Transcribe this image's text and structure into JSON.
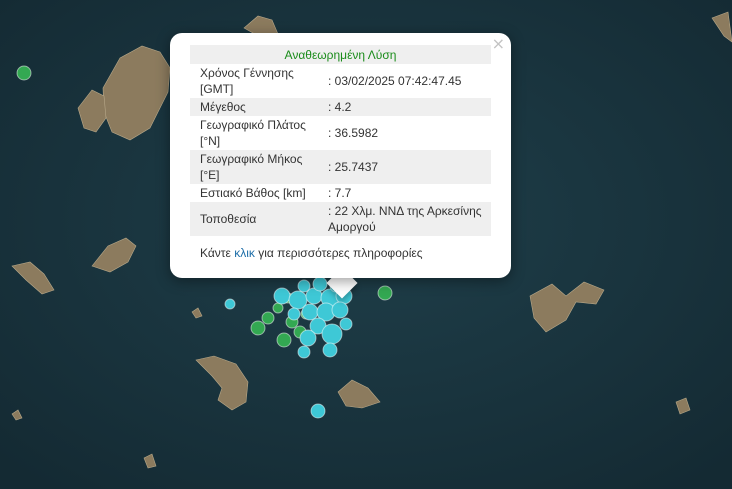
{
  "popup": {
    "title": "Αναθεωρημένη Λύση",
    "close_glyph": "×",
    "rows": [
      {
        "label": "Χρόνος Γέννησης [GMT]",
        "value": ": 03/02/2025 07:42:47.45"
      },
      {
        "label": "Μέγεθος",
        "value": ": 4.2"
      },
      {
        "label": "Γεωγραφικό Πλάτος [°N]",
        "value": ": 36.5982"
      },
      {
        "label": "Γεωγραφικό Μήκος [°E]",
        "value": ": 25.7437"
      },
      {
        "label": "Εστιακό Βάθος [km]",
        "value": ": 7.7"
      },
      {
        "label": "Τοποθεσία",
        "value": ": 22 Χλμ. ΝΝΔ της Αρκεσίνης Αμοργού"
      }
    ],
    "more": {
      "prefix": "Κάντε ",
      "link": "κλικ",
      "suffix": " για περισσότερες πληροφορίες"
    }
  },
  "colors": {
    "sea": "#19323c",
    "land": "#8a7a5c",
    "marker_recent": "#3ec8d6",
    "marker_older": "#33a852",
    "title_green": "#1a8c1a",
    "link": "#1d6ea8"
  },
  "marker_types": [
    "recent-earthquake",
    "older-earthquake"
  ]
}
